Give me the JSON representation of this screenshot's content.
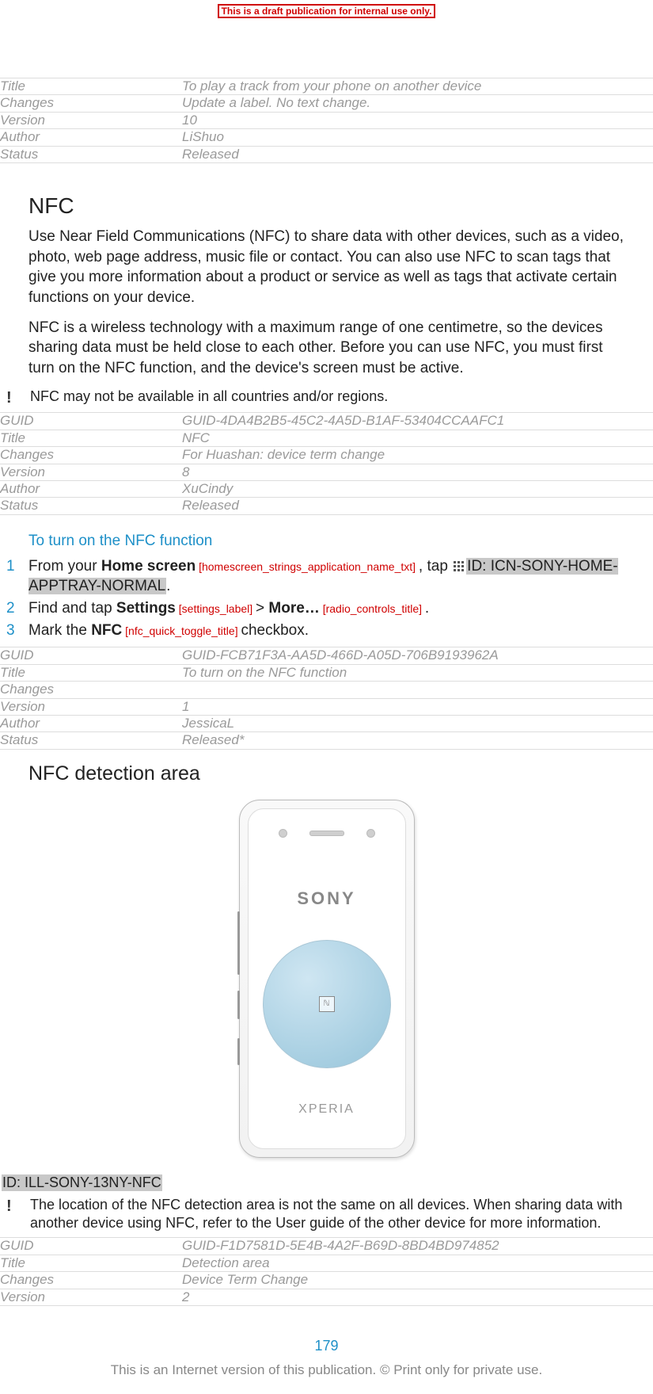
{
  "banner": "This is a draft publication for internal use only.",
  "meta1": [
    {
      "k": "Title",
      "v": "To play a track from your phone on another device"
    },
    {
      "k": "Changes",
      "v": "Update a label. No text change."
    },
    {
      "k": "Version",
      "v": "10"
    },
    {
      "k": "Author",
      "v": "LiShuo"
    },
    {
      "k": "Status",
      "v": "Released"
    }
  ],
  "h1": "NFC",
  "p1": "Use Near Field Communications (NFC) to share data with other devices, such as a video, photo, web page address, music file or contact. You can also use NFC to scan tags that give you more information about a product or service as well as tags that activate certain functions on your device.",
  "p2": "NFC is a wireless technology with a maximum range of one centimetre, so the devices sharing data must be held close to each other. Before you can use NFC, you must first turn on the NFC function, and the device's screen must be active.",
  "note1": "NFC may not be available in all countries and/or regions.",
  "meta2": [
    {
      "k": "GUID",
      "v": "GUID-4DA4B2B5-45C2-4A5D-B1AF-53404CCAAFC1"
    },
    {
      "k": "Title",
      "v": "NFC"
    },
    {
      "k": "Changes",
      "v": "For Huashan: device term change"
    },
    {
      "k": "Version",
      "v": "8"
    },
    {
      "k": "Author",
      "v": "XuCindy"
    },
    {
      "k": "Status",
      "v": "Released"
    }
  ],
  "sub1": "To turn on the NFC function",
  "steps": {
    "s1_a": "From your ",
    "s1_home": "Home screen",
    "s1_ref1": " [homescreen_strings_application_name_txt] ",
    "s1_b": ", tap ",
    "s1_icon_id": "ID: ICN-SONY-HOME-APPTRAY-NORMAL",
    "s1_c": ".",
    "s2_a": "Find and tap ",
    "s2_settings": "Settings",
    "s2_ref1": " [settings_label] ",
    "s2_gt": " > ",
    "s2_more": "More…",
    "s2_ref2": " [radio_controls_title] ",
    "s2_c": ".",
    "s3_a": "Mark the ",
    "s3_nfc": "NFC",
    "s3_ref1": " [nfc_quick_toggle_title] ",
    "s3_b": "checkbox."
  },
  "meta3": [
    {
      "k": "GUID",
      "v": "GUID-FCB71F3A-AA5D-466D-A05D-706B9193962A"
    },
    {
      "k": "Title",
      "v": "To turn on the NFC function"
    },
    {
      "k": "Changes",
      "v": ""
    },
    {
      "k": "Version",
      "v": "1"
    },
    {
      "k": "Author",
      "v": "JessicaL"
    },
    {
      "k": "Status",
      "v": "Released*"
    }
  ],
  "h2": "NFC detection area",
  "phone": {
    "brand": "SONY",
    "series": "XPERIA"
  },
  "ill_id": "ID: ILL-SONY-13NY-NFC",
  "note2": "The location of the NFC detection area is not the same on all devices. When sharing data with another device using NFC, refer to the User guide of the other device for more information.",
  "meta4": [
    {
      "k": "GUID",
      "v": "GUID-F1D7581D-5E4B-4A2F-B69D-8BD4BD974852"
    },
    {
      "k": "Title",
      "v": "Detection area"
    },
    {
      "k": "Changes",
      "v": "Device Term Change"
    },
    {
      "k": "Version",
      "v": "2"
    }
  ],
  "page_number": "179",
  "copyright": "This is an Internet version of this publication. © Print only for private use."
}
